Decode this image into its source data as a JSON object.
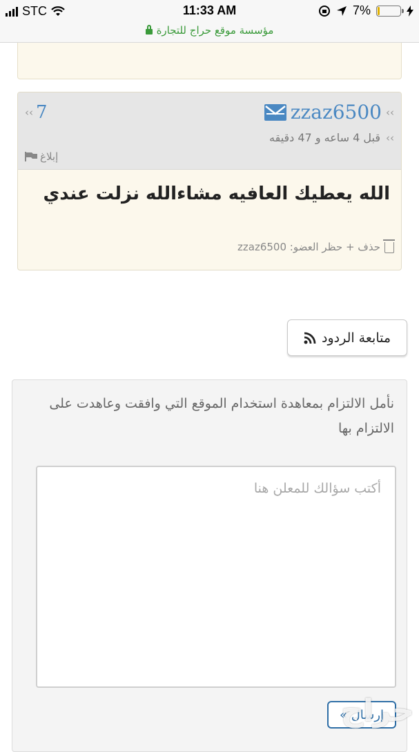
{
  "status_bar": {
    "carrier": "STC",
    "time": "11:33 AM",
    "battery_percent": "7%",
    "battery_level": 0.07,
    "battery_color": "#e0b000"
  },
  "url_bar": {
    "site_name": "مؤسسة موقع حراج للتجارة",
    "secure_color": "#3a9a3a"
  },
  "comment": {
    "username": "zzaz6500",
    "number": "7",
    "time_ago": "قبل 4 ساعه و 47 دقيقه",
    "report_label": "إبلاغ",
    "text": "الله يعطيك العافيه مشاءالله نزلت عندي",
    "admin_action": "حذف + حظر العضو: zzaz6500",
    "link_color": "#4a88c2"
  },
  "follow_button": {
    "label": "متابعة الردود"
  },
  "question_form": {
    "notice": "نأمل الالتزام بمعاهدة استخدام الموقع التي وافقت وعاهدت على الالتزام بها",
    "placeholder": "أكتب سؤالك للمعلن هنا",
    "send_label": "إرسال »",
    "accent_color": "#2e6ea6"
  },
  "watermark": {
    "text": "حراج"
  }
}
